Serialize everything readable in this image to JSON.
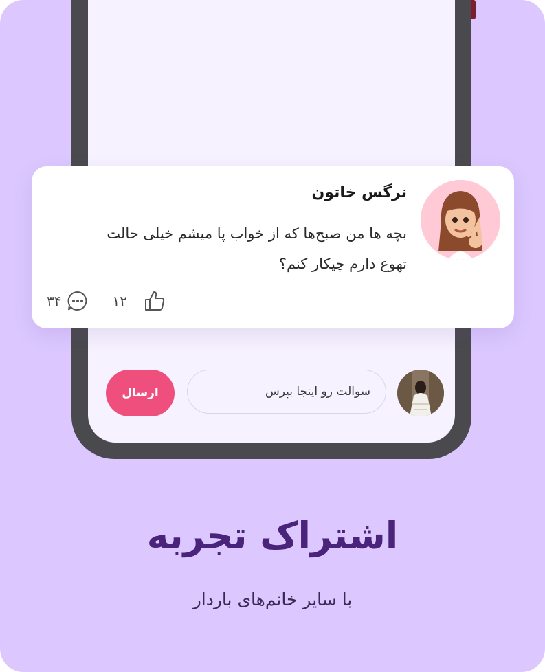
{
  "comment": {
    "author": "نرگس خاتون",
    "body": "بچه ها من صبح‌ها که از خواب پا میشم خیلی حالت تهوع دارم چیکار کنم؟",
    "likes": "۱۲",
    "replies": "۳۴"
  },
  "composer": {
    "placeholder": "سوالت رو اینجا بپرس",
    "send_label": "ارسال"
  },
  "promo": {
    "title": "اشتراک تجربه",
    "subtitle": "با سایر خانم‌های باردار"
  },
  "colors": {
    "background": "#dcc8ff",
    "accent": "#ef4f7d",
    "headline": "#4a237a"
  },
  "icons": {
    "like": "thumbs-up-icon",
    "reply": "chat-bubble-icon"
  }
}
